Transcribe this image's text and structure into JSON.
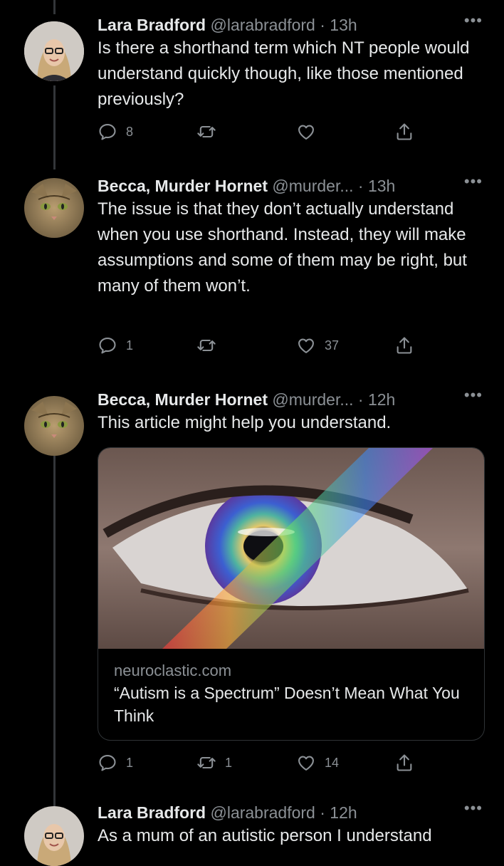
{
  "tweets": [
    {
      "name": "Lara Bradford",
      "meta": "@larabradford · 13h",
      "text": "Is there a shorthand term which NT people would understand quickly though, like those mentioned previously?",
      "replies": "8",
      "retweets": "",
      "likes": ""
    },
    {
      "name": "Becca, Murder Hornet",
      "meta": "@murder... · 13h",
      "text": "The issue is that they don’t actually understand when you use shorthand. Instead, they will make assumptions and some of them may be right, but many of them won’t.",
      "replies": "1",
      "retweets": "",
      "likes": "37"
    },
    {
      "name": "Becca, Murder Hornet",
      "meta": "@murder... · 12h",
      "text": "This article might help you understand.",
      "card": {
        "domain": "neuroclastic.com",
        "title": "“Autism is a Spectrum” Doesn’t Mean What You Think"
      },
      "replies": "1",
      "retweets": "1",
      "likes": "14"
    },
    {
      "name": "Lara Bradford",
      "meta": "@larabradford · 12h",
      "text": "As a mum of an autistic person I understand"
    }
  ],
  "more_label": "•••",
  "icons": [
    "reply-icon",
    "retweet-icon",
    "like-icon",
    "share-icon",
    "more-icon"
  ]
}
